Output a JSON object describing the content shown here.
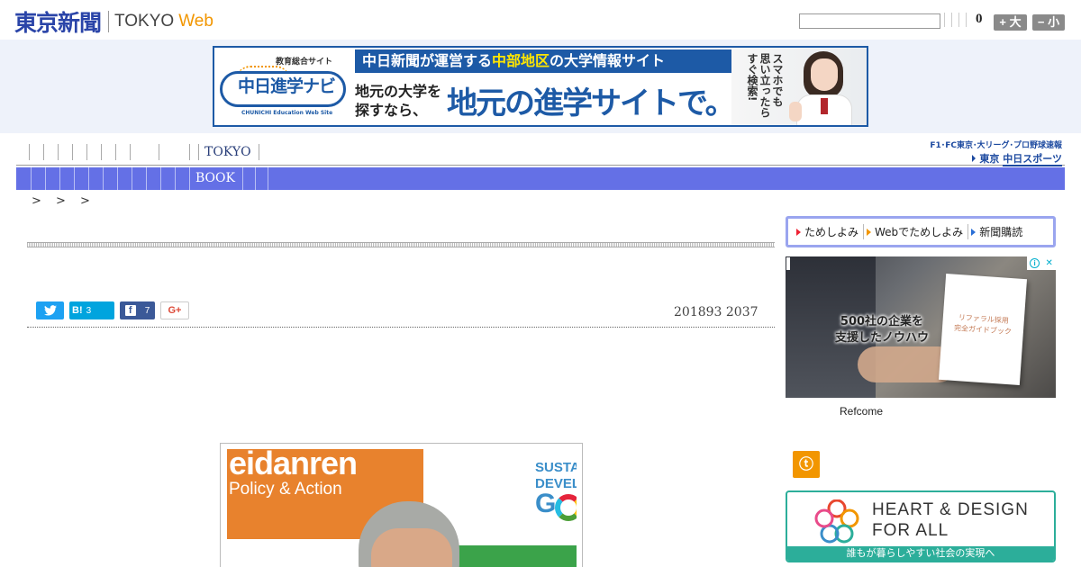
{
  "header": {
    "logo_main": "東京新聞",
    "logo_tokyo": "TOKYO",
    "logo_web": "Web",
    "search_placeholder": "",
    "count": "0",
    "font_large": "+ 大",
    "font_small": "− 小"
  },
  "banner": {
    "small_label": "教育総合サイト",
    "logo_text": "中日進学ナビ",
    "logo_sub": "CHUNICHI Education Web Site",
    "headline_pre": "中日新聞が運営する",
    "headline_hl": "中部地区",
    "headline_post": "の大学情報サイト",
    "left_line1": "地元の大学を",
    "left_line2": "探すなら、",
    "big_text": "地元の進学サイトで。",
    "vertical_col1": "スマホでも",
    "vertical_col2": "思い立ったら",
    "vertical_col3": "すぐ検索!"
  },
  "nav1": {
    "label": "TOKYO"
  },
  "chunichi_link": {
    "top": "F1･FC東京･大リーグ･プロ野球速報",
    "brand_small": "東京",
    "brand": "中日スポーツ"
  },
  "nav2": {
    "label": "BOOK"
  },
  "breadcrumb": "> > >",
  "share": {
    "hatena_label": "B!",
    "hatena_count": "3",
    "facebook_count": "7",
    "gplus_label": "G+"
  },
  "article": {
    "date": "201893 2037"
  },
  "photo": {
    "sign_line1": "eidanren",
    "sign_line2": "Policy & Action",
    "sdg_line1": "SUSTA",
    "sdg_line2": "DEVEL",
    "sdg_g": "G"
  },
  "sidebar": {
    "links": [
      "ためしよみ",
      "Webでためしよみ",
      "新聞購読"
    ],
    "ad_text_line1": "500社の企業を",
    "ad_text_line2": "支援したノウハウ",
    "ad_book_line1": "リファラル採用",
    "ad_book_line2": "完全ガイドブック",
    "ad_choice_x": "✕",
    "ad_source": "Refcome",
    "hd_line1": "HEART & DESIGN",
    "hd_line2": "FOR ALL",
    "hd_bar": "誰もが暮らしやすい社会の実現へ"
  },
  "colors": {
    "brand_blue": "#2a44a8",
    "nav_bar": "#6470e6",
    "web_orange": "#f29600",
    "hd_teal": "#2cae9a"
  }
}
